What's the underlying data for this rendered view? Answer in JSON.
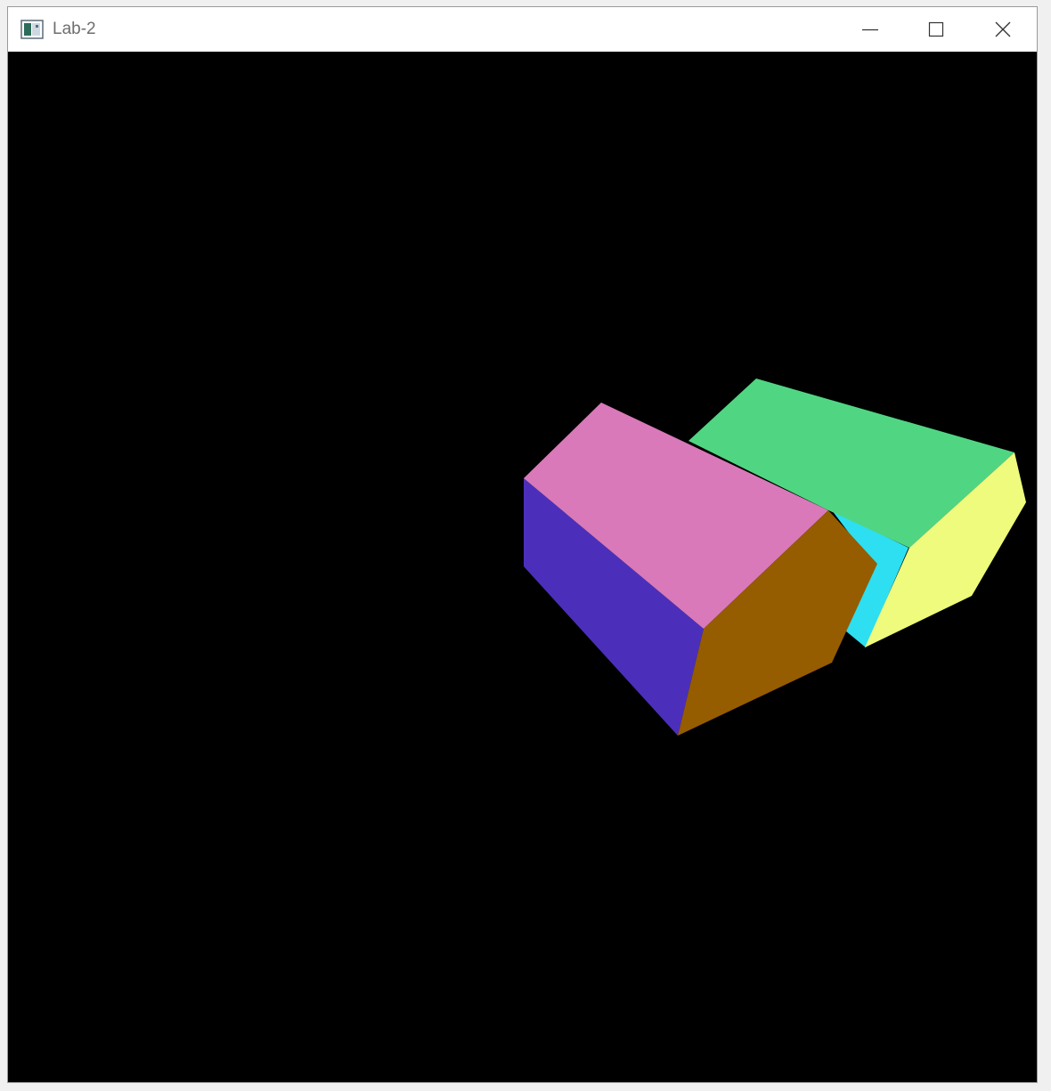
{
  "window": {
    "title": "Lab-2",
    "controls": {
      "minimize_icon": "minimize-icon",
      "maximize_icon": "maximize-icon",
      "close_icon": "close-icon"
    }
  },
  "scene": {
    "background": "#000000",
    "faces": {
      "top_front_box": "#d979b9",
      "left_front_box": "#4b2fbb",
      "right_front_box": "#955c00",
      "top_back_box": "#50d682",
      "end_back_box": "#eefb7d",
      "side_back_box": "#2ddff0"
    }
  }
}
